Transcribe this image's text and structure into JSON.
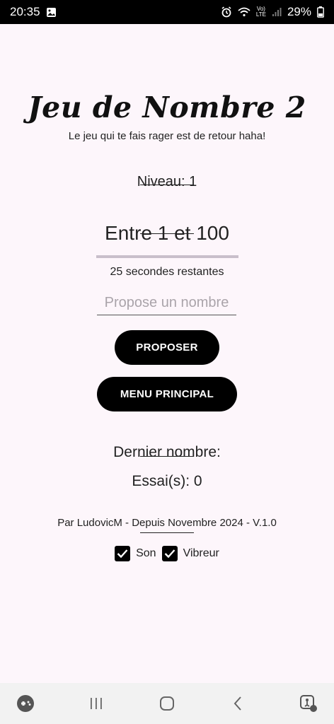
{
  "status_bar": {
    "time": "20:35",
    "battery": "29%",
    "network": "LTE",
    "signal": "Vo)"
  },
  "app": {
    "title": "Jeu de Nombre 2",
    "subtitle": "Le jeu qui te fais rager est de retour haha!",
    "level": "Niveau: 1",
    "range": "Entre 1 et 100",
    "timer": "25 secondes restantes",
    "input_placeholder": "Propose un nombre",
    "propose_label": "PROPOSER",
    "menu_label": "MENU PRINCIPAL",
    "last_number": "Dernier nombre:",
    "attempts": "Essai(s): 0",
    "credits": "Par LudovicM - Depuis Novembre 2024 - V.1.0",
    "sound_label": "Son",
    "vibrate_label": "Vibreur"
  },
  "icons": {
    "gallery": "image-icon",
    "alarm": "alarm-icon",
    "wifi": "wifi-icon",
    "signal": "signal-icon",
    "nav_game": "game-launcher-icon",
    "nav_recents": "recents-icon",
    "nav_home": "home-icon",
    "nav_back": "back-icon",
    "nav_assist": "accessibility-icon"
  },
  "colors": {
    "background": "#fdf6fb",
    "button": "#000000",
    "underline": "#c9bfcb"
  }
}
